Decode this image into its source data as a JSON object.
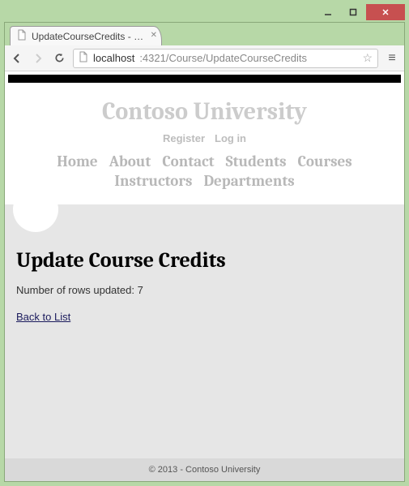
{
  "window": {
    "tab_title": "UpdateCourseCredits - Co"
  },
  "toolbar": {
    "url_host": "localhost",
    "url_port_path": ":4321/Course/UpdateCourseCredits"
  },
  "site": {
    "title": "Contoso University",
    "account": {
      "register": "Register",
      "login": "Log in"
    },
    "nav": {
      "home": "Home",
      "about": "About",
      "contact": "Contact",
      "students": "Students",
      "courses": "Courses",
      "instructors": "Instructors",
      "departments": "Departments"
    }
  },
  "page": {
    "heading": "Update Course Credits",
    "result_prefix": "Number of rows updated: ",
    "result_count": "7",
    "back_link": "Back to List"
  },
  "footer": {
    "text": "© 2013 - Contoso University"
  }
}
